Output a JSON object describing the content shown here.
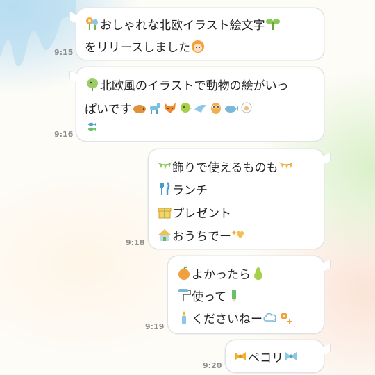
{
  "messages": [
    {
      "time": "9:15",
      "lines": [
        "おしゃれな北欧イラスト絵文字",
        "をリリースしました"
      ]
    },
    {
      "time": "9:16",
      "lines": [
        "北欧風のイラストで動物の絵がいっ",
        "ぱいです"
      ]
    },
    {
      "time": "9:18",
      "lines": [
        "飾りで使えるものも",
        "ランチ",
        "プレゼント",
        "おうちでー"
      ]
    },
    {
      "time": "9:19",
      "lines": [
        "よかったら",
        "使って",
        "くださいねー"
      ]
    },
    {
      "time": "9:20",
      "lines": [
        "ペコリ"
      ]
    }
  ],
  "colors": {
    "bubble": "#ffffff",
    "border": "#dfe3e6",
    "time": "#8f8f8f"
  }
}
